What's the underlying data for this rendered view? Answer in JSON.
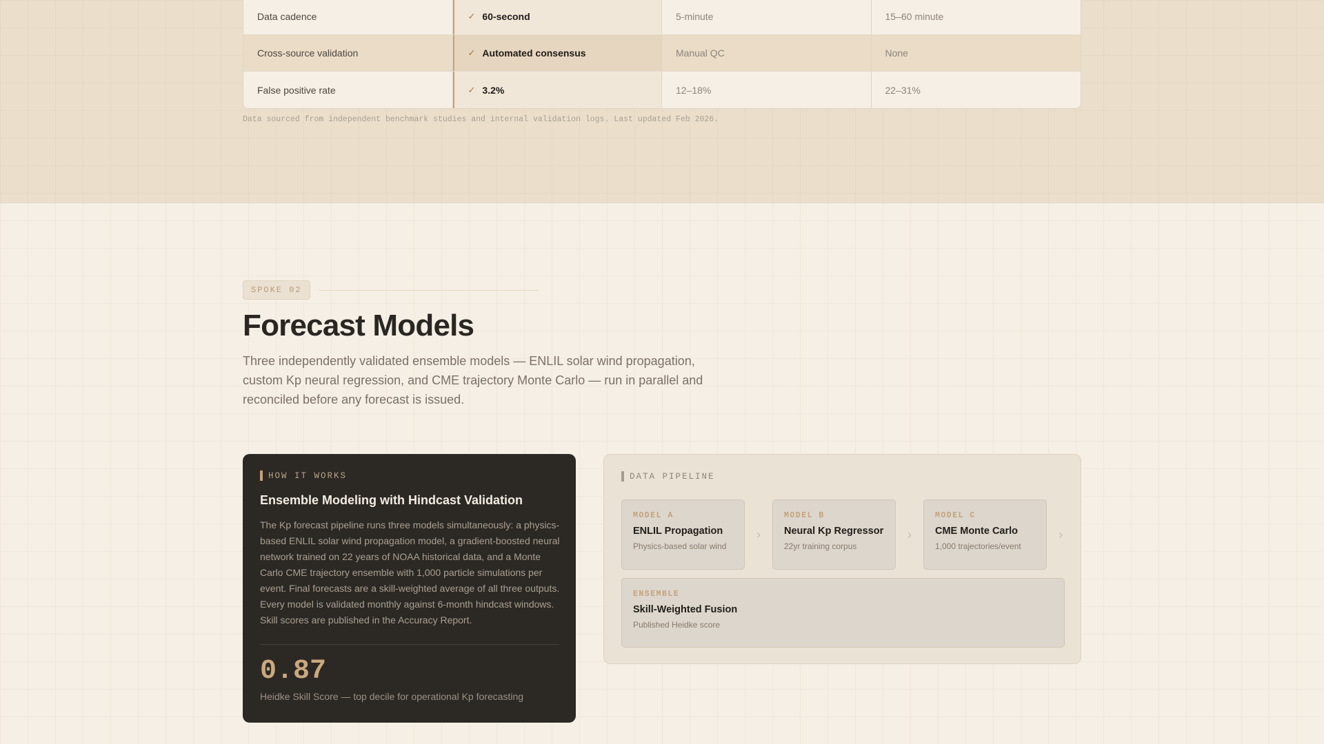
{
  "comparison": {
    "rows": [
      {
        "feature": "Data cadence",
        "ours": "60-second",
        "alt1": "5-minute",
        "alt2": "15–60 minute"
      },
      {
        "feature": "Cross-source validation",
        "ours": "Automated consensus",
        "alt1": "Manual QC",
        "alt2": "None"
      },
      {
        "feature": "False positive rate",
        "ours": "3.2%",
        "alt1": "12–18%",
        "alt2": "22–31%"
      }
    ],
    "check_glyph": "✓",
    "footnote": "Data sourced from independent benchmark studies and internal validation logs. Last updated Feb 2026."
  },
  "section": {
    "badge": "SPOKE 02",
    "title": "Forecast Models",
    "description": "Three independently validated ensemble models — ENLIL solar wind propagation, custom Kp neural regression, and CME trajectory Monte Carlo — run in parallel and reconciled before any forecast is issued."
  },
  "how_it_works": {
    "label": "HOW IT WORKS",
    "title": "Ensemble Modeling with Hindcast Validation",
    "body": "The Kp forecast pipeline runs three models simultaneously: a physics-based ENLIL solar wind propagation model, a gradient-boosted neural network trained on 22 years of NOAA historical data, and a Monte Carlo CME trajectory ensemble with 1,000 particle simulations per event. Final forecasts are a skill-weighted average of all three outputs. Every model is validated monthly against 6-month hindcast windows. Skill scores are published in the Accuracy Report.",
    "score": "0.87",
    "score_caption": "Heidke Skill Score — top decile for operational Kp forecasting"
  },
  "pipeline": {
    "label": "DATA PIPELINE",
    "chevron": "›",
    "models": [
      {
        "tag": "MODEL A",
        "name": "ENLIL Propagation",
        "sub": "Physics-based solar wind"
      },
      {
        "tag": "MODEL B",
        "name": "Neural Kp Regressor",
        "sub": "22yr training corpus"
      },
      {
        "tag": "MODEL C",
        "name": "CME Monte Carlo",
        "sub": "1,000 trajectories/event"
      }
    ],
    "ensemble": {
      "tag": "ENSEMBLE",
      "name": "Skill-Weighted Fusion",
      "sub": "Published Heidke score"
    }
  },
  "colors": {
    "accent": "#c4a27a",
    "dark_card": "#2c2824",
    "page_bg": "#f5efe5",
    "band_bg": "#ebdfcc"
  }
}
